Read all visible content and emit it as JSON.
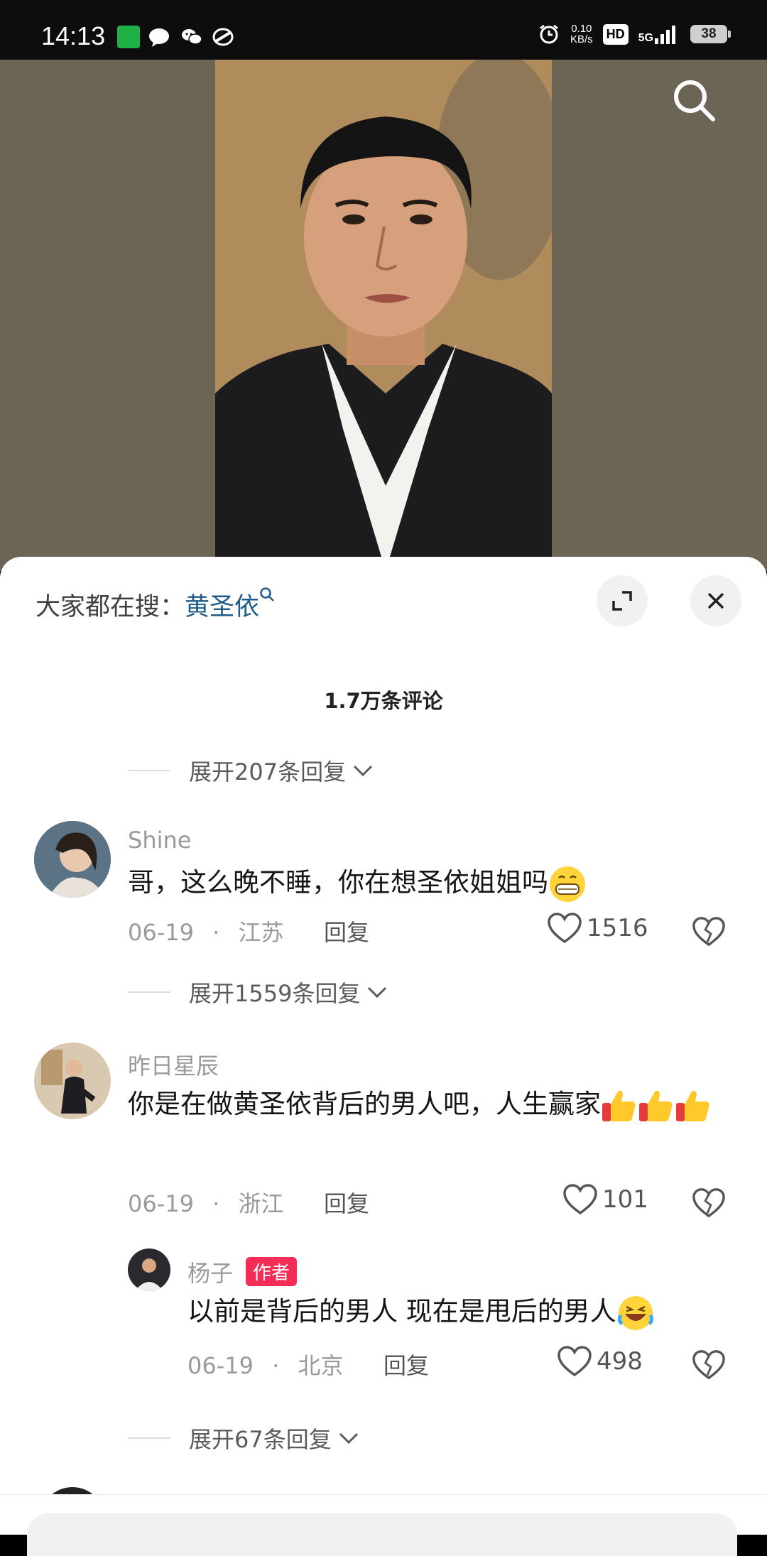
{
  "status_bar": {
    "time": "14:13",
    "network_speed_value": "0.10",
    "network_speed_unit": "KB/s",
    "hd_label": "HD",
    "signal_label": "5G",
    "battery": "38"
  },
  "sheet": {
    "hot_search_prefix": "大家都在搜：",
    "hot_search_term": "黄圣依",
    "comment_count": "1.7万条评论"
  },
  "expand_replies": [
    {
      "label": "展开207条回复"
    },
    {
      "label": "展开1559条回复"
    },
    {
      "label": "展开67条回复"
    }
  ],
  "comments": [
    {
      "name": "Shine",
      "text": "哥，这么晚不睡，你在想圣依姐姐吗",
      "date": "06-19",
      "location": "江苏",
      "reply_label": "回复",
      "likes": "1516"
    },
    {
      "name": "昨日星辰",
      "text_line1": "你是在做黄圣依背后的男人吧，人生赢家",
      "date": "06-19",
      "location": "浙江",
      "reply_label": "回复",
      "likes": "101"
    },
    {
      "name": "杨子",
      "badge": "作者",
      "text": "以前是背后的男人 现在是甩后的男人",
      "date": "06-19",
      "location": "北京",
      "reply_label": "回复",
      "likes": "498"
    }
  ],
  "separator": "·",
  "colors": {
    "hot_term": "#1e5a8a",
    "author_badge": "#f52c56",
    "sheet_bg": "#ffffff",
    "video_bg": "#6c6455"
  }
}
